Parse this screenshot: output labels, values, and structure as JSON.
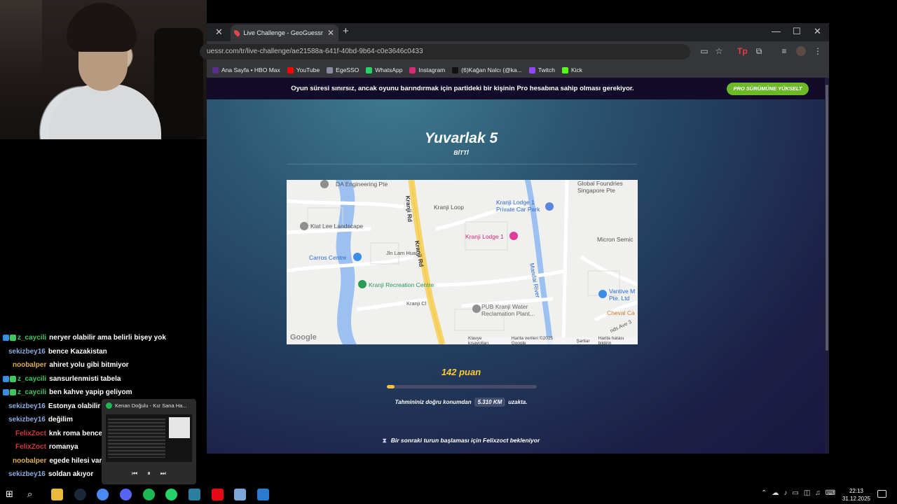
{
  "browser": {
    "tab_title": "Live Challenge - GeoGuessr",
    "url": "uessr.com/tr/live-challenge/ae21588a-641f-40bd-9b64-c0e3646c0433",
    "bookmarks": [
      {
        "label": "Ana Sayfa • HBO Max",
        "color": "#5b2d90"
      },
      {
        "label": "YouTube",
        "color": "#ff0000"
      },
      {
        "label": "EgeSSO",
        "color": "#8a8aa0"
      },
      {
        "label": "WhatsApp",
        "color": "#25d366"
      },
      {
        "label": "Instagram",
        "color": "#d62976"
      },
      {
        "label": "(6)Kağan Nalcı (@ka...",
        "color": "#111111"
      },
      {
        "label": "Twitch",
        "color": "#9146ff"
      },
      {
        "label": "Kick",
        "color": "#53fc18"
      }
    ]
  },
  "banner": {
    "message": "Oyun süresi sınırsız, ancak oyunu barındırmak için partideki bir kişinin Pro hesabına sahip olması gerekiyor.",
    "pro_button": "PRO SÜRÜMÜNE YÜKSELT"
  },
  "round": {
    "title": "Yuvarlak 5",
    "subtitle": "BİTTİ"
  },
  "map": {
    "labels": {
      "da_engineering": "DA Engineering Pte",
      "kranji_rd_1": "Kranji Rd",
      "kranji_rd_2": "Kranji Rd",
      "kranji_loop": "Kranji Loop",
      "kranji_lodge_car_park": "Kranji Lodge 1\nPrivate Car Park",
      "global_foundries": "Global Foundries\nSingapore Pte",
      "kiat_lee": "Kiat Lee Landscape",
      "kranji_lodge": "Kranji Lodge 1",
      "micron": "Micron Semic",
      "carros": "Carros Centre",
      "jln_lam_huat": "Jln Lam Huat",
      "mandai_river": "Mandai River",
      "recreation": "Kranji Recreation Centre",
      "vantive": "Vantive M\nPte. Ltd",
      "kranji_cl": "Kranji Cl",
      "pub_water": "PUB Kranji Water\nReclamation Plant...",
      "cheval": "Cheval Ca",
      "ave3": "nds Ave 3",
      "google": "Google",
      "footer_shortcuts": "Klavye kısayolları",
      "footer_data": "Harita verileri ©2025 Google",
      "footer_terms": "Şartlar",
      "footer_report": "Harita hatası bildirin"
    }
  },
  "result": {
    "points_label": "142 puan",
    "progress_fraction": 0.05,
    "distance_prefix": "Tahmininiz doğru konumdan",
    "distance_value": "5.310 KM",
    "distance_suffix": "uzakta.",
    "waiting": "Bir sonraki turun başlaması için Felixzoct bekleniyor"
  },
  "chat": [
    {
      "user": "z_caycili",
      "msg": "neryer olabilir ama belirli bişey yok",
      "color": "#44c45c",
      "badges": true
    },
    {
      "user": "sekizbey16",
      "msg": "bence Kazakistan",
      "color": "#8ea9e0",
      "badges": false
    },
    {
      "user": "noobalper",
      "msg": "ahiret yolu gibi bitmiyor",
      "color": "#e0b050",
      "badges": false
    },
    {
      "user": "z_caycili",
      "msg": "sansurlenmisti tabela",
      "color": "#44c45c",
      "badges": true
    },
    {
      "user": "z_caycili",
      "msg": "ben kahve yapip geliyom",
      "color": "#44c45c",
      "badges": true
    },
    {
      "user": "sekizbey16",
      "msg": "Estonya olabilir",
      "color": "#8ea9e0",
      "badges": false
    },
    {
      "user": "sekizbey16",
      "msg": "değilim",
      "color": "#8ea9e0",
      "badges": false
    },
    {
      "user": "FelixZoct",
      "msg": "knk roma bence",
      "color": "#d23a3a",
      "badges": false
    },
    {
      "user": "FelixZoct",
      "msg": "romanya",
      "color": "#d23a3a",
      "badges": false
    },
    {
      "user": "noobalper",
      "msg": "egede hilesi var belli etmiyor şuan",
      "color": "#e0b050",
      "badges": false
    },
    {
      "user": "sekizbey16",
      "msg": "soldan akıyor",
      "color": "#8ea9e0",
      "badges": false
    }
  ],
  "media": {
    "title": "Kenan Doğulu - Kız Sana Ha..."
  },
  "taskbar": {
    "time": "22:13",
    "date": "31.12.2025"
  },
  "icons": {
    "accent_green": "#6cb928",
    "points_color": "#ffcc33"
  }
}
